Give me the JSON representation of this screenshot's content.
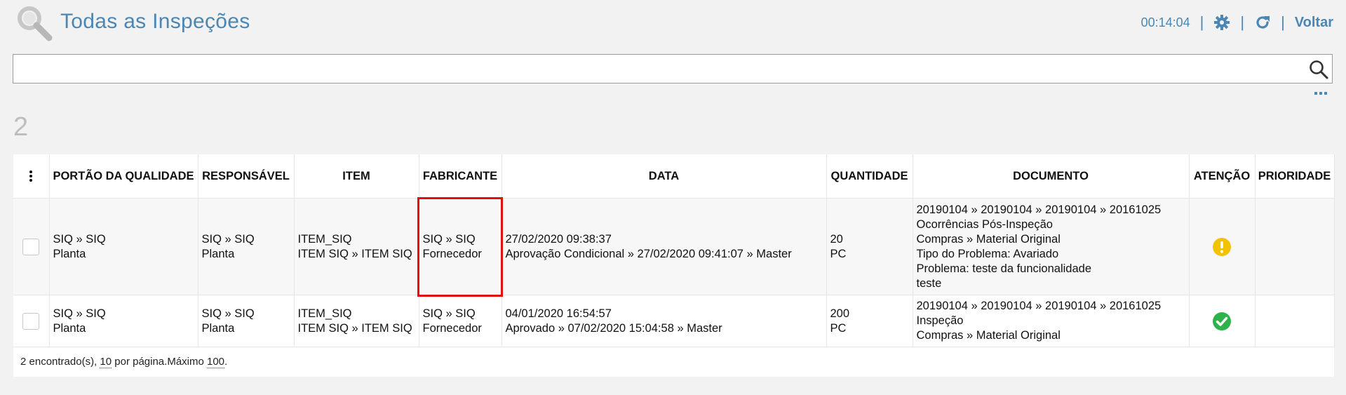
{
  "header": {
    "title": "Todas as Inspeções",
    "timer": "00:14:04",
    "back_label": "Voltar"
  },
  "search": {
    "value": "",
    "placeholder": ""
  },
  "result_count": "2",
  "table": {
    "columns": [
      "PORTÃO DA QUALIDADE",
      "RESPONSÁVEL",
      "ITEM",
      "FABRICANTE",
      "DATA",
      "QUANTIDADE",
      "DOCUMENTO",
      "ATENÇÃO",
      "PRIORIDADE"
    ],
    "rows": [
      {
        "portao": [
          "SIQ » SIQ",
          "Planta"
        ],
        "responsavel": [
          "SIQ » SIQ",
          "Planta"
        ],
        "item": [
          "ITEM_SIQ",
          "ITEM SIQ » ITEM SIQ"
        ],
        "fabricante": [
          "SIQ » SIQ",
          "Fornecedor"
        ],
        "data": [
          "27/02/2020 09:38:37",
          "Aprovação Condicional » 27/02/2020 09:41:07 » Master"
        ],
        "quantidade": [
          "20",
          "PC"
        ],
        "documento": [
          "20190104 » 20190104 » 20190104 » 20161025",
          "Ocorrências Pós-Inspeção",
          "Compras » Material Original",
          "Tipo do Problema: Avariado",
          "Problema: teste da funcionalidade",
          "teste"
        ],
        "atencao_icon": "warning-icon",
        "prioridade": ""
      },
      {
        "portao": [
          "SIQ » SIQ",
          "Planta"
        ],
        "responsavel": [
          "SIQ » SIQ",
          "Planta"
        ],
        "item": [
          "ITEM_SIQ",
          "ITEM SIQ » ITEM SIQ"
        ],
        "fabricante": [
          "SIQ » SIQ",
          "Fornecedor"
        ],
        "data": [
          "04/01/2020 16:54:57",
          "Aprovado » 07/02/2020 15:04:58 » Master"
        ],
        "quantidade": [
          "200",
          "PC"
        ],
        "documento": [
          "20190104 » 20190104 » 20190104 » 20161025",
          "Inspeção",
          "Compras » Material Original"
        ],
        "atencao_icon": "check-icon",
        "prioridade": ""
      }
    ]
  },
  "footer": {
    "found_text": "2 encontrado(s), ",
    "per_page_value": "10",
    "per_page_text": " por página.Máximo ",
    "max_value": "100",
    "end": "."
  },
  "colors": {
    "accent": "#4a87b4",
    "warning": "#f2c200",
    "success": "#2fb24a",
    "highlight": "#e01010"
  }
}
